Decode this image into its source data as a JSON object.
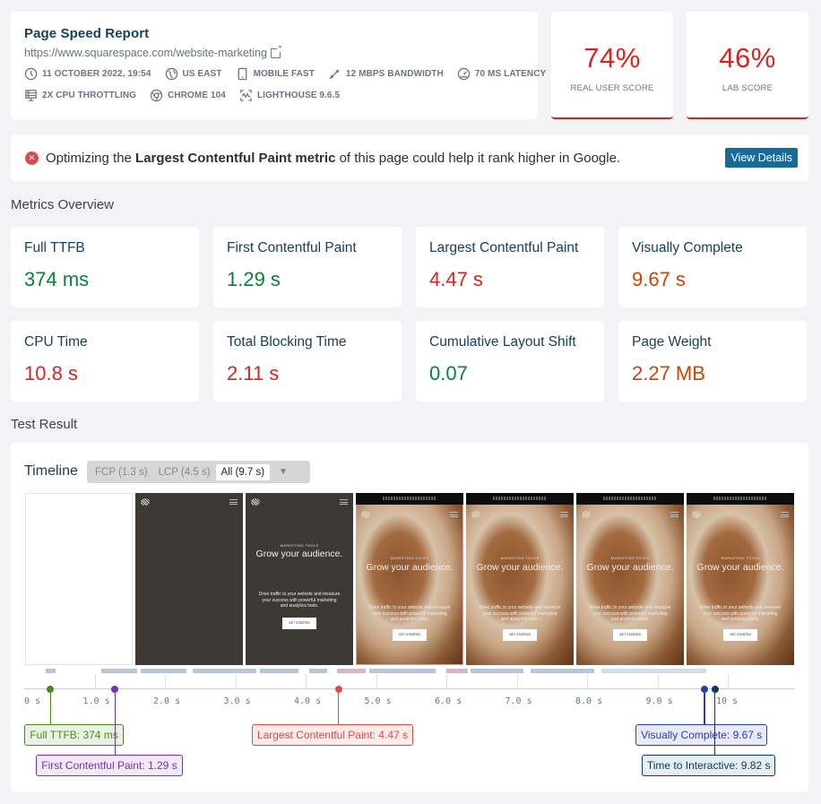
{
  "header": {
    "title": "Page Speed Report",
    "url": "https://www.squarespace.com/website-marketing",
    "meta_row_1": [
      {
        "icon": "clock-icon",
        "label": "11 OCTOBER 2022, 19:54"
      },
      {
        "icon": "globe-icon",
        "label": "US EAST"
      },
      {
        "icon": "mobile-icon",
        "label": "MOBILE FAST"
      },
      {
        "icon": "bandwidth-icon",
        "label": "12 MBPS BANDWIDTH"
      },
      {
        "icon": "gauge-icon",
        "label": "70 MS LATENCY"
      }
    ],
    "meta_row_2": [
      {
        "icon": "cpu-icon",
        "label": "2X CPU THROTTLING"
      },
      {
        "icon": "chrome-icon",
        "label": "CHROME 104"
      },
      {
        "icon": "lighthouse-icon",
        "label": "LIGHTHOUSE 9.6.5"
      }
    ]
  },
  "scores": {
    "real_user": {
      "value": "74%",
      "label": "REAL USER SCORE"
    },
    "lab": {
      "value": "46%",
      "label": "LAB SCORE"
    },
    "accent_color": "#d9231e"
  },
  "alert": {
    "icon": "error-x-icon",
    "prefix": "Optimizing the ",
    "bold": "Largest Contentful Paint metric",
    "suffix": " of this page could help it rank higher in Google.",
    "button": "View Details"
  },
  "metrics_overview": {
    "title": "Metrics Overview",
    "items": [
      {
        "name": "Full TTFB",
        "value": "374 ms",
        "status": "good"
      },
      {
        "name": "First Contentful Paint",
        "value": "1.29 s",
        "status": "good"
      },
      {
        "name": "Largest Contentful Paint",
        "value": "4.47 s",
        "status": "poor"
      },
      {
        "name": "Visually Complete",
        "value": "9.67 s",
        "status": "avg"
      },
      {
        "name": "CPU Time",
        "value": "10.8 s",
        "status": "poor"
      },
      {
        "name": "Total Blocking Time",
        "value": "2.11 s",
        "status": "poor"
      },
      {
        "name": "Cumulative Layout Shift",
        "value": "0.07",
        "status": "good"
      },
      {
        "name": "Page Weight",
        "value": "2.27 MB",
        "status": "avg"
      }
    ],
    "colors": {
      "good": "#0e7e3c",
      "poor": "#d9231e",
      "avg": "#c94406"
    }
  },
  "test_result": {
    "title": "Test Result",
    "timeline": {
      "title": "Timeline",
      "options": [
        "FCP (1.3 s)",
        "LCP (4.5 s)",
        "All (9.7 s)"
      ],
      "selected": "All (9.7 s)",
      "frames": [
        {
          "type": "blank"
        },
        {
          "type": "dark-header"
        },
        {
          "type": "dark-hero",
          "kicker": "MARKETING TOOLS",
          "hero": "Grow your audience.",
          "body": "Drive traffic to your website and measure your success with powerful marketing and analytics tools.",
          "cta": "GET STARTED"
        },
        {
          "type": "photo",
          "lcp": true,
          "kicker": "MARKETING TOOLS",
          "hero": "Grow your audience.",
          "body": "Drive traffic to your website and measure your success with powerful marketing and analytics tools.",
          "cta": "GET STARTED"
        },
        {
          "type": "photo",
          "kicker": "MARKETING TOOLS",
          "hero": "Grow your audience.",
          "body": "Drive traffic to your website and measure your success with powerful marketing and analytics tools.",
          "cta": "GET STARTED"
        },
        {
          "type": "photo",
          "kicker": "MARKETING TOOLS",
          "hero": "Grow your audience.",
          "body": "Drive traffic to your website and measure your success with powerful marketing and analytics tools.",
          "cta": "GET STARTED"
        },
        {
          "type": "photo",
          "kicker": "MARKETING TOOLS",
          "hero": "Grow your audience.",
          "body": "Drive traffic to your website and measure your success with powerful marketing and analytics tools.",
          "cta": "GET STARTED"
        }
      ],
      "axis": {
        "min_s": 0,
        "max_s": 10.9,
        "ticks": [
          {
            "value": 0,
            "label": "0 s"
          },
          {
            "value": 1,
            "label": "1.0 s"
          },
          {
            "value": 2,
            "label": "2.0 s"
          },
          {
            "value": 3,
            "label": "3.0 s"
          },
          {
            "value": 4,
            "label": "4.0 s"
          },
          {
            "value": 5,
            "label": "5.0 s"
          },
          {
            "value": 6,
            "label": "6.0 s"
          },
          {
            "value": 7,
            "label": "7.0 s"
          },
          {
            "value": 8,
            "label": "8.0 s"
          },
          {
            "value": 9,
            "label": "9.0 s"
          },
          {
            "value": 10,
            "label": "10 s"
          }
        ]
      },
      "markers": [
        {
          "key": "ttfb",
          "time_s": 0.374,
          "label": "Full TTFB: 374 ms",
          "color": "#4c8b17"
        },
        {
          "key": "fcp",
          "time_s": 1.29,
          "label": "First Contentful Paint: 1.29 s",
          "color": "#7a2fb0"
        },
        {
          "key": "lcpc",
          "time_s": 4.47,
          "label": "Largest Contentful Paint: 4.47 s",
          "color": "#e04848"
        },
        {
          "key": "vc",
          "time_s": 9.67,
          "label": "Visually Complete: 9.67 s",
          "color": "#2d3ea8"
        },
        {
          "key": "tti",
          "time_s": 9.82,
          "label": "Time to Interactive: 9.82 s",
          "color": "#0f3b52"
        }
      ],
      "request_segments": [
        {
          "start_s": 0.3,
          "end_s": 0.45,
          "kind": "req"
        },
        {
          "start_s": 1.1,
          "end_s": 1.6,
          "kind": "req"
        },
        {
          "start_s": 1.65,
          "end_s": 2.3,
          "kind": "req"
        },
        {
          "start_s": 2.4,
          "end_s": 3.3,
          "kind": "req"
        },
        {
          "start_s": 3.35,
          "end_s": 3.9,
          "kind": "req"
        },
        {
          "start_s": 4.05,
          "end_s": 4.3,
          "kind": "req"
        },
        {
          "start_s": 4.45,
          "end_s": 4.85,
          "kind": "lcp"
        },
        {
          "start_s": 4.9,
          "end_s": 5.85,
          "kind": "req"
        },
        {
          "start_s": 6.0,
          "end_s": 6.3,
          "kind": "lcp"
        },
        {
          "start_s": 6.35,
          "end_s": 7.1,
          "kind": "req"
        },
        {
          "start_s": 7.2,
          "end_s": 8.1,
          "kind": "req"
        },
        {
          "start_s": 8.2,
          "end_s": 9.7,
          "kind": "req-light"
        }
      ]
    }
  }
}
